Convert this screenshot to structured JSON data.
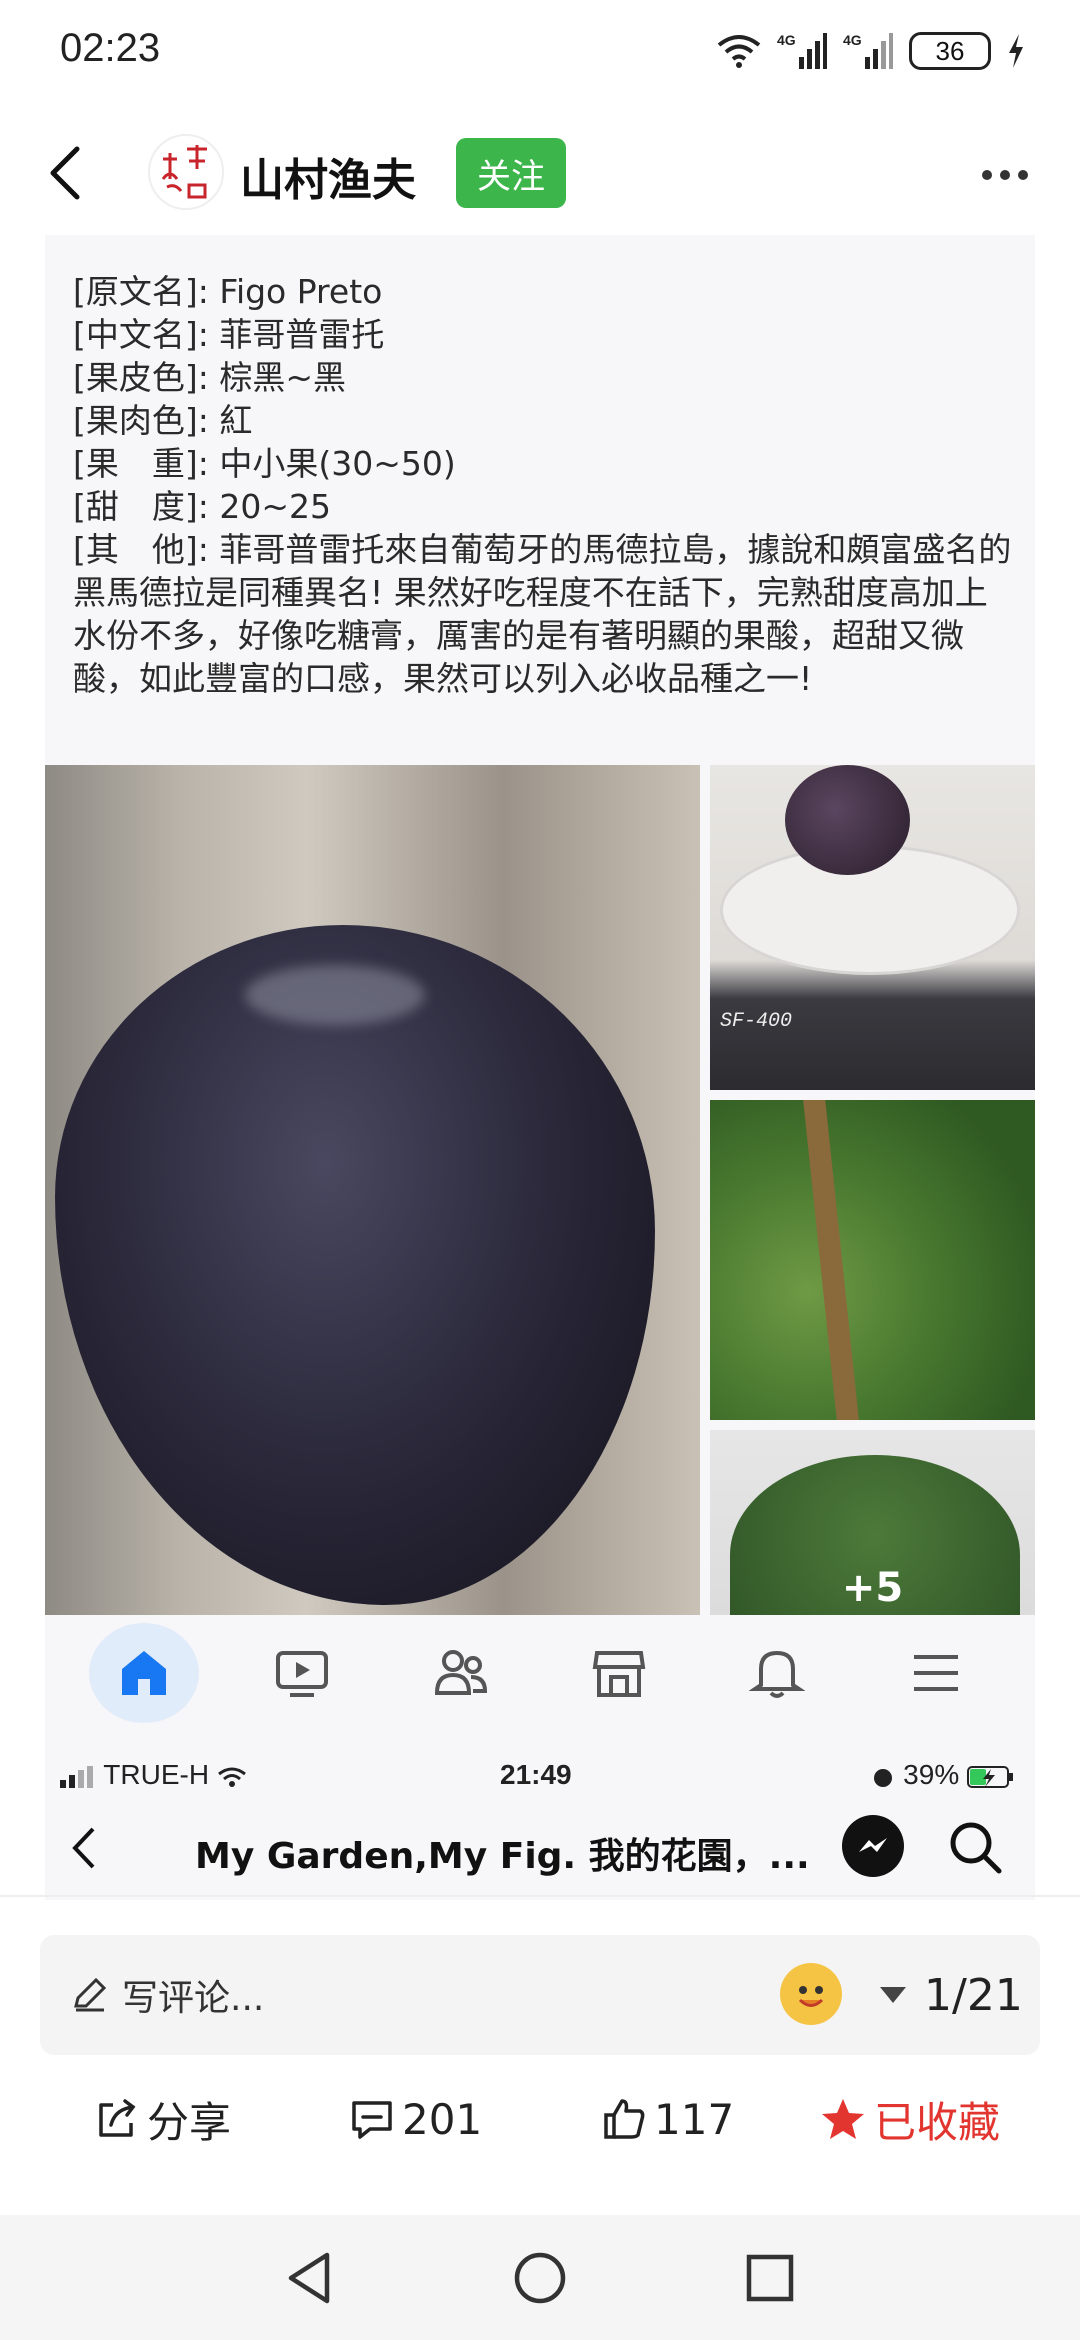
{
  "status_bar": {
    "time": "02:23",
    "battery": "36",
    "signal_1": "4G",
    "signal_2": "4G"
  },
  "header": {
    "author": "山村渔夫",
    "follow_label": "关注"
  },
  "post": {
    "spec_lines": [
      "[原文名]: Figo Preto",
      "[中文名]: 菲哥普雷托",
      "[果皮色]: 棕黑~黑",
      "[果肉色]: 紅",
      "[果　重]: 中小果(30~50)",
      "[甜　度]: 20~25"
    ],
    "description": "[其　他]: 菲哥普雷托來自葡萄牙的馬德拉島，據說和頗富盛名的黑馬德拉是同種異名! 果然好吃程度不在話下，完熟甜度高加上水份不多，好像吃糖膏，厲害的是有著明顯的果酸，超甜又微酸，如此豐富的口感，果然可以列入必收品種之一!",
    "scale_label": "SF-400",
    "more_photos": "+5"
  },
  "embedded": {
    "carrier": "TRUE-H",
    "time": "21:49",
    "battery": "39%",
    "title": "My Garden,My Fig. 我的花園，..."
  },
  "comment_bar": {
    "placeholder": "写评论...",
    "page_indicator": "1/21"
  },
  "actions": {
    "share": "分享",
    "comments": "201",
    "likes": "117",
    "favorite": "已收藏"
  },
  "colors": {
    "follow_green": "#3cb54a",
    "favorite_red": "#e3352f",
    "fb_blue": "#1877f2"
  }
}
